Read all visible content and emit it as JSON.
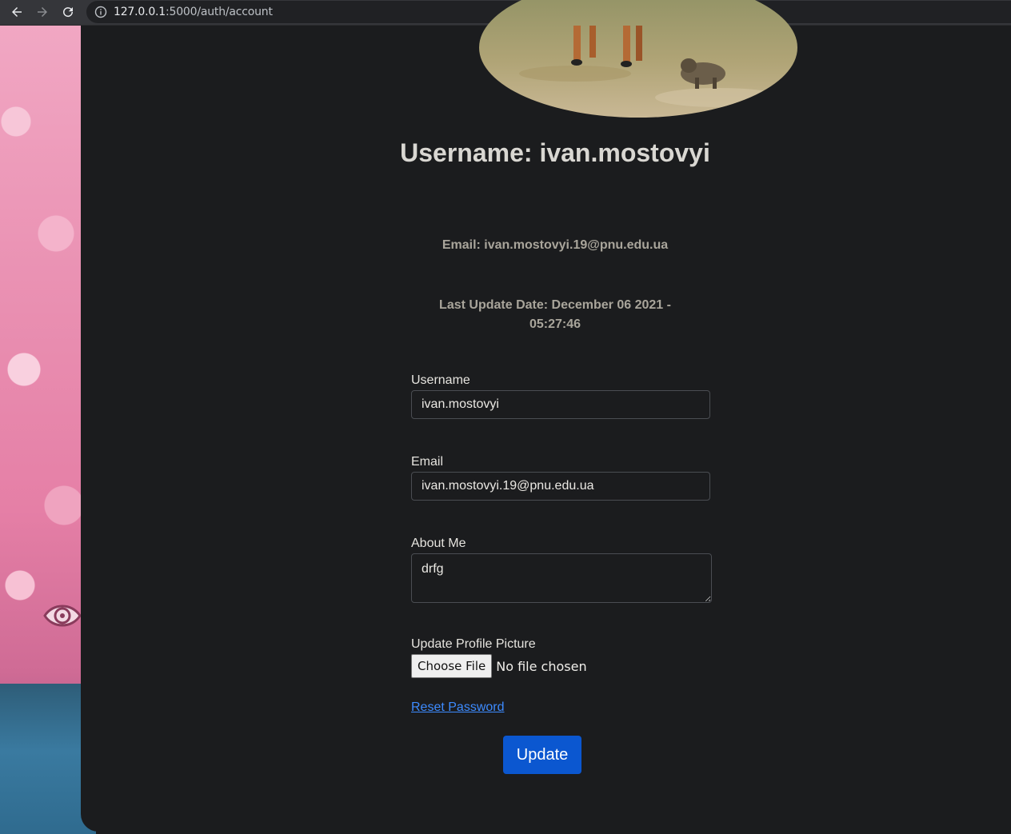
{
  "browser": {
    "url_host": "127.0.0.1",
    "url_path": ":5000/auth/account"
  },
  "profile": {
    "username_heading": "Username: ivan.mostovyi",
    "email_line": "Email: ivan.mostovyi.19@pnu.edu.ua",
    "last_update": "Last Update Date: December 06 2021 - 05:27:46"
  },
  "form": {
    "username_label": "Username",
    "username_value": "ivan.mostovyi",
    "email_label": "Email",
    "email_value": "ivan.mostovyi.19@pnu.edu.ua",
    "about_label": "About Me",
    "about_value": "drfg",
    "picture_label": "Update Profile Picture",
    "choose_file_label": "Choose File",
    "no_file_text": "No file chosen",
    "reset_password_label": "Reset Password",
    "update_button_label": "Update"
  },
  "colors": {
    "accent": "#0b57d0",
    "link": "#3d8bff",
    "card_bg": "#1b1c1e"
  },
  "icons": [
    "back-arrow-icon",
    "forward-arrow-icon",
    "reload-icon",
    "info-icon",
    "eye-icon"
  ]
}
